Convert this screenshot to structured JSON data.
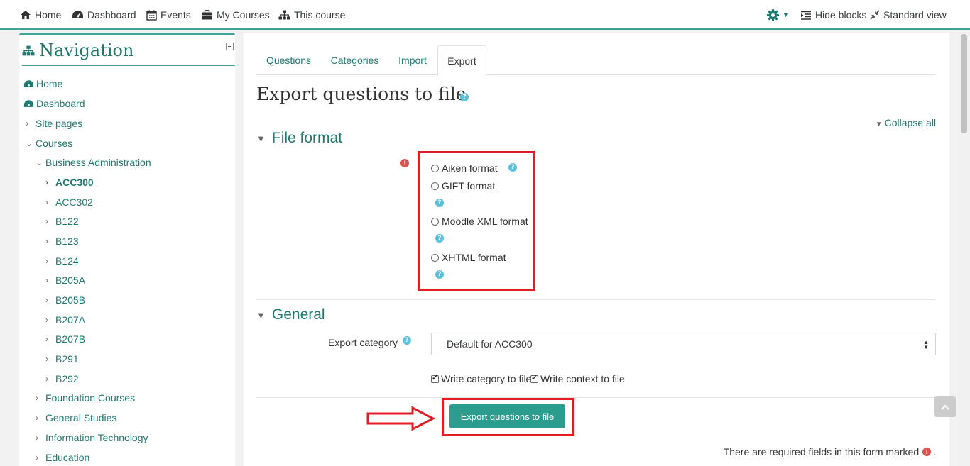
{
  "topbar": {
    "home": "Home",
    "dashboard": "Dashboard",
    "events": "Events",
    "my_courses": "My Courses",
    "this_course": "This course",
    "hide_blocks": "Hide blocks",
    "standard_view": "Standard view"
  },
  "navigation": {
    "title": "Navigation",
    "items": [
      {
        "label": "Home"
      },
      {
        "label": "Dashboard"
      },
      {
        "label": "Site pages"
      },
      {
        "label": "Courses"
      },
      {
        "label": "Business Administration"
      },
      {
        "label": "ACC300"
      },
      {
        "label": "ACC302"
      },
      {
        "label": "B122"
      },
      {
        "label": "B123"
      },
      {
        "label": "B124"
      },
      {
        "label": "B205A"
      },
      {
        "label": "B205B"
      },
      {
        "label": "B207A"
      },
      {
        "label": "B207B"
      },
      {
        "label": "B291"
      },
      {
        "label": "B292"
      },
      {
        "label": "Foundation Courses"
      },
      {
        "label": "General Studies"
      },
      {
        "label": "Information Technology"
      },
      {
        "label": "Education"
      }
    ]
  },
  "tabs": [
    {
      "label": "Questions"
    },
    {
      "label": "Categories"
    },
    {
      "label": "Import"
    },
    {
      "label": "Export"
    }
  ],
  "page": {
    "title": "Export questions to file",
    "collapse_all": "Collapse all",
    "file_format_heading": "File format",
    "formats": [
      {
        "label": "Aiken format"
      },
      {
        "label": "GIFT format"
      },
      {
        "label": "Moodle XML format"
      },
      {
        "label": "XHTML format"
      }
    ],
    "general_heading": "General",
    "export_category_label": "Export category",
    "export_category_value": "Default for ACC300",
    "write_category": "Write category to file",
    "write_context": "Write context to file",
    "submit_label": "Export questions to file",
    "required_note": "There are required fields in this form marked",
    "required_note_end": "."
  },
  "colors": {
    "accent": "#3fa39a",
    "link": "#1e7a70",
    "button": "#2a9d8f",
    "annotation_red": "#e31b23",
    "help_blue": "#5bc0de"
  }
}
